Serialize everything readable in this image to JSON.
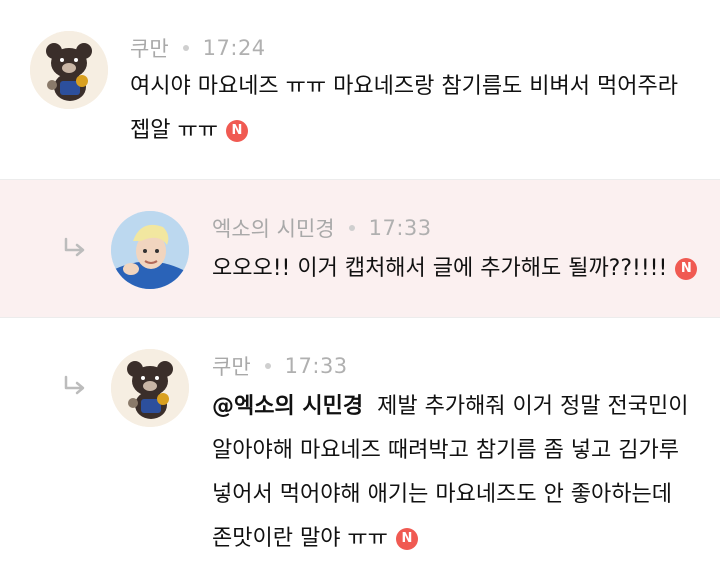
{
  "comments": [
    {
      "author": "쿠만",
      "time": "17:24",
      "is_reply": false,
      "lines": [
        "여시야 마요네즈 ㅠㅠ 마요네즈랑 참기름도 비벼서 먹어주라",
        "젭알 ㅠㅠ"
      ],
      "new_badge": "N"
    },
    {
      "author": "엑소의 시민경",
      "time": "17:33",
      "is_reply": true,
      "lines": [
        "오오오!! 이거 캡처해서 글에 추가해도 될까??!!!!"
      ],
      "new_badge": "N"
    },
    {
      "author": "쿠만",
      "time": "17:33",
      "is_reply": true,
      "mention": "@엑소의 시민경",
      "first_line_rest": "제발 추가해줘 이거 정말 전국민이",
      "lines": [
        "알아야해 마요네즈 때려박고 참기름 좀 넣고 김가루",
        "넣어서 먹어야해 애기는 마요네즈도 안 좋아하는데",
        "존맛이란 말야 ㅠㅠ"
      ],
      "new_badge": "N"
    }
  ],
  "colors": {
    "new_badge": "#f05a52",
    "highlight_bg": "#fbf0f0",
    "meta": "#a9a9a9"
  },
  "icons": {
    "reply": "reply-arrow-icon",
    "new": "new-badge-icon"
  }
}
